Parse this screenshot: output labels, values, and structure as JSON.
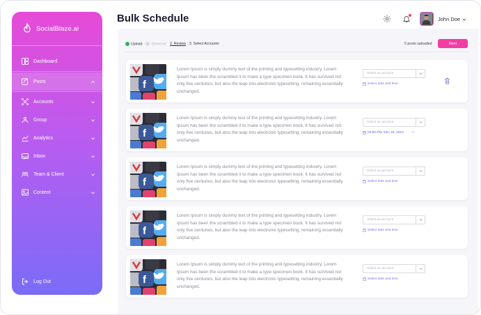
{
  "app": {
    "brand": "SocialBlaze.ai",
    "accent": "#f23ea2",
    "sidebar_gradient": [
      "#e74ad6",
      "#b95cf0",
      "#7a6cf7"
    ]
  },
  "sidebar": {
    "items": [
      {
        "label": "Dashboard",
        "icon": "dashboard-icon",
        "expandable": false
      },
      {
        "label": "Posts",
        "icon": "posts-icon",
        "expandable": true,
        "expanded": true
      },
      {
        "label": "Accounts",
        "icon": "accounts-icon",
        "expandable": true
      },
      {
        "label": "Group",
        "icon": "group-icon",
        "expandable": true
      },
      {
        "label": "Analytics",
        "icon": "analytics-icon",
        "expandable": true
      },
      {
        "label": "Inbox",
        "icon": "inbox-icon",
        "expandable": true
      },
      {
        "label": "Team & Client",
        "icon": "team-icon",
        "expandable": true
      },
      {
        "label": "Content",
        "icon": "content-icon",
        "expandable": true
      }
    ],
    "logout": "Log Out"
  },
  "header": {
    "title": "Bulk Schedule",
    "icons": [
      "settings-icon",
      "bell-icon"
    ],
    "user_name": "John Doe"
  },
  "steps": [
    {
      "label": "Upload",
      "state": "done"
    },
    {
      "label": "Generate",
      "state": "muted"
    },
    {
      "label": "2. Review",
      "state": "current"
    },
    {
      "label": "3. Select Accounts",
      "state": "pending"
    }
  ],
  "upload_status": "5 posts uploaded",
  "next_label": "Next",
  "posts": [
    {
      "text": "Lorem Ipsum is simply dummy text of the printing and typesetting industry. Lorem Ipsum has been the scrambled it to make a type specimen book. It has survived not only five centuries, but also the leap into electronic typesetting, remaining essentially unchanged.",
      "account_placeholder": "Select an account",
      "date": "Select date and time",
      "date_set": false,
      "show_delete": true
    },
    {
      "text": "Lorem Ipsum is simply dummy text of the printing and typesetting industry. Lorem Ipsum has been the scrambled it to make a type specimen book. It has survived not only five centuries, but also the leap into electronic typesetting, remaining essentially unchanged.",
      "account_placeholder": "Select an account",
      "date": "04:00 PM, Dec 19, 2024",
      "date_set": true,
      "show_delete": false
    },
    {
      "text": "Lorem Ipsum is simply dummy text of the printing and typesetting industry. Lorem Ipsum has been the scrambled it to make a type specimen book. It has survived not only five centuries, but also the leap into electronic typesetting, remaining essentially unchanged.",
      "account_placeholder": "Select an account",
      "date": "Select date and time",
      "date_set": false,
      "show_delete": false
    },
    {
      "text": "Lorem Ipsum is simply dummy text of the printing and typesetting industry. Lorem Ipsum has been the scrambled it to make a type specimen book. It has survived not only five centuries, but also the leap into electronic typesetting, remaining essentially unchanged.",
      "account_placeholder": "Select an account",
      "date": "Select date and time",
      "date_set": false,
      "show_delete": false
    },
    {
      "text": "Lorem Ipsum is simply dummy text of the printing and typesetting industry. Lorem Ipsum has been the scrambled it to make a type specimen book. It has survived not only five centuries, but also the leap into electronic typesetting, remaining essentially unchanged.",
      "account_placeholder": "Select an account",
      "date": "Select date and time",
      "date_set": false,
      "show_delete": false
    }
  ]
}
